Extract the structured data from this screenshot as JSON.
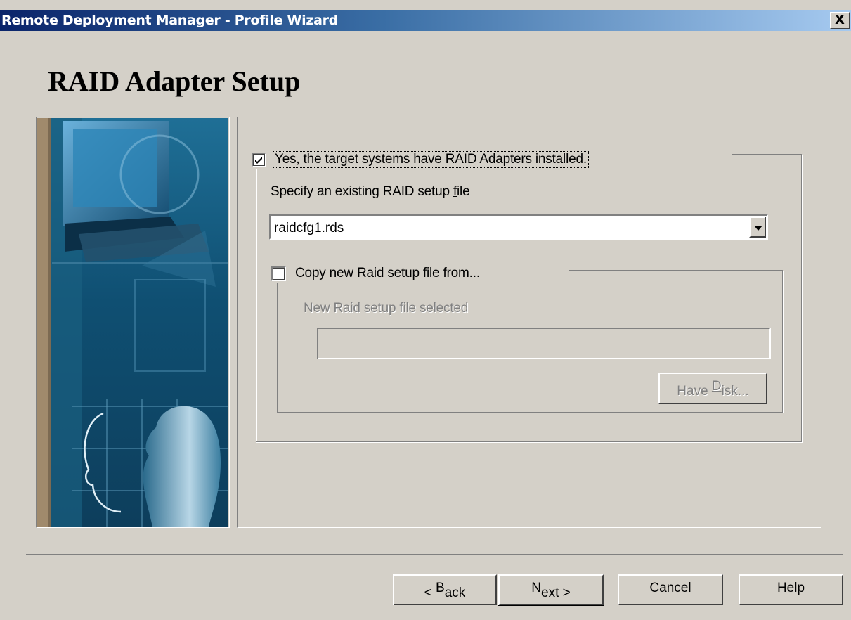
{
  "window": {
    "title": "Remote Deployment Manager - Profile Wizard",
    "close_label": "X"
  },
  "page": {
    "heading": "RAID Adapter Setup"
  },
  "raid_group": {
    "checkbox_checked": true,
    "checkbox_label_before": "Yes, the target systems have ",
    "checkbox_label_mnemonic": "R",
    "checkbox_label_after": "AID Adapters installed.",
    "specify_label_before": "Specify an existing RAID setup ",
    "specify_label_mnemonic": "f",
    "specify_label_after": "ile",
    "selected_file": "raidcfg1.rds"
  },
  "copy_group": {
    "checkbox_checked": false,
    "checkbox_label_mnemonic": "C",
    "checkbox_label_after": "opy new Raid setup file from...",
    "selected_label": "New Raid setup file selected",
    "selected_value": "",
    "have_disk_before": "Have ",
    "have_disk_mnemonic": "D",
    "have_disk_after": "isk..."
  },
  "buttons": {
    "back_prefix": "< ",
    "back_mnemonic": "B",
    "back_after": "ack",
    "next_mnemonic": "N",
    "next_after": "ext >",
    "cancel": "Cancel",
    "help": "Help"
  },
  "colors": {
    "titlebar_start": "#0a246a",
    "titlebar_end": "#a6caf0",
    "dialog_face": "#d4d0c8"
  }
}
